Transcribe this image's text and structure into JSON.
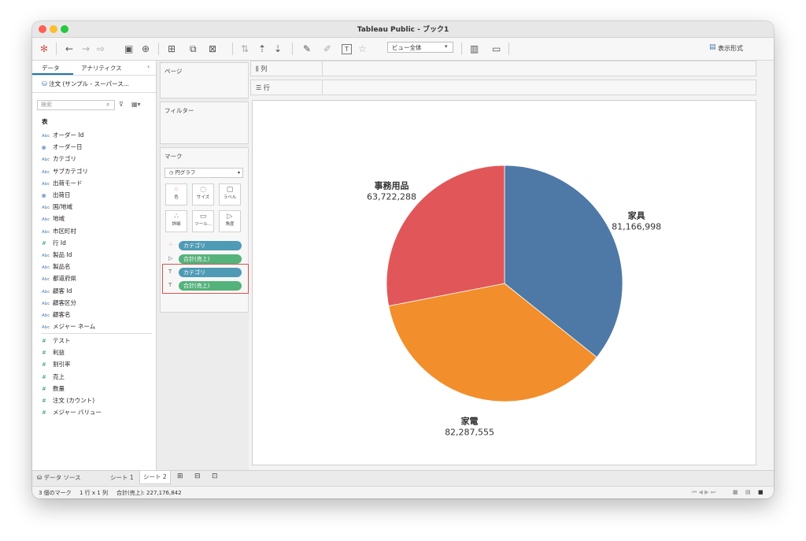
{
  "window": {
    "title": "Tableau Public - ブック1"
  },
  "toolbar": {
    "view_select": "ビュー全体",
    "show_me": "表示形式"
  },
  "left_panel": {
    "tabs": [
      "データ",
      "アナリティクス"
    ],
    "data_source": "注文 (サンプル - スーパース...",
    "search_placeholder": "検索",
    "table_header": "表",
    "dimensions": [
      {
        "type": "Abc",
        "label": "オーダー Id"
      },
      {
        "type": "date",
        "label": "オーダー日"
      },
      {
        "type": "Abc",
        "label": "カテゴリ"
      },
      {
        "type": "Abc",
        "label": "サブカテゴリ"
      },
      {
        "type": "Abc",
        "label": "出荷モード"
      },
      {
        "type": "date",
        "label": "出荷日"
      },
      {
        "type": "Abc",
        "label": "国/地域"
      },
      {
        "type": "Abc",
        "label": "地域"
      },
      {
        "type": "Abc",
        "label": "市区町村"
      },
      {
        "type": "#",
        "label": "行 Id"
      },
      {
        "type": "Abc",
        "label": "製品 Id"
      },
      {
        "type": "Abc",
        "label": "製品名"
      },
      {
        "type": "Abc",
        "label": "都道府県"
      },
      {
        "type": "Abc",
        "label": "顧客 Id"
      },
      {
        "type": "Abc",
        "label": "顧客区分"
      },
      {
        "type": "Abc",
        "label": "顧客名"
      },
      {
        "type": "Abc",
        "label": "メジャー ネーム"
      }
    ],
    "measures": [
      {
        "type": "#",
        "label": "テスト"
      },
      {
        "type": "#",
        "label": "利益"
      },
      {
        "type": "#",
        "label": "割引率"
      },
      {
        "type": "#",
        "label": "売上"
      },
      {
        "type": "#",
        "label": "数量"
      },
      {
        "type": "#",
        "label": "注文 (カウント)"
      },
      {
        "type": "#",
        "label": "メジャー バリュー"
      }
    ]
  },
  "shelves": {
    "pages": "ページ",
    "filters": "フィルター",
    "marks": "マーク",
    "mark_type": "円グラフ",
    "mark_buttons": [
      "色",
      "サイズ",
      "ラベル",
      "詳細",
      "ツール...",
      "角度"
    ],
    "pills": [
      {
        "label": "カテゴリ",
        "kind": "color",
        "color": "#4f9bb5"
      },
      {
        "label": "合計(売上)",
        "kind": "angle",
        "color": "#54b27b"
      },
      {
        "label": "カテゴリ",
        "kind": "label",
        "color": "#4f9bb5"
      },
      {
        "label": "合計(売上)",
        "kind": "label",
        "color": "#54b27b"
      }
    ],
    "columns": "列",
    "rows": "行"
  },
  "chart_data": {
    "type": "pie",
    "slices": [
      {
        "label": "家具",
        "value": 81166998,
        "display": "81,166,998",
        "color": "#4e79a7"
      },
      {
        "label": "家電",
        "value": 82287555,
        "display": "82,287,555",
        "color": "#f28e2b"
      },
      {
        "label": "事務用品",
        "value": 63722288,
        "display": "63,722,288",
        "color": "#e15759"
      }
    ]
  },
  "bottom": {
    "data_source_tab": "データ ソース",
    "sheets": [
      "シート 1",
      "シート 2"
    ],
    "active_sheet": "シート 2"
  },
  "status": {
    "marks": "3 個のマーク",
    "rows_cols": "1 行 x 1 列",
    "sum": "合計(売上): 227,176,842"
  }
}
